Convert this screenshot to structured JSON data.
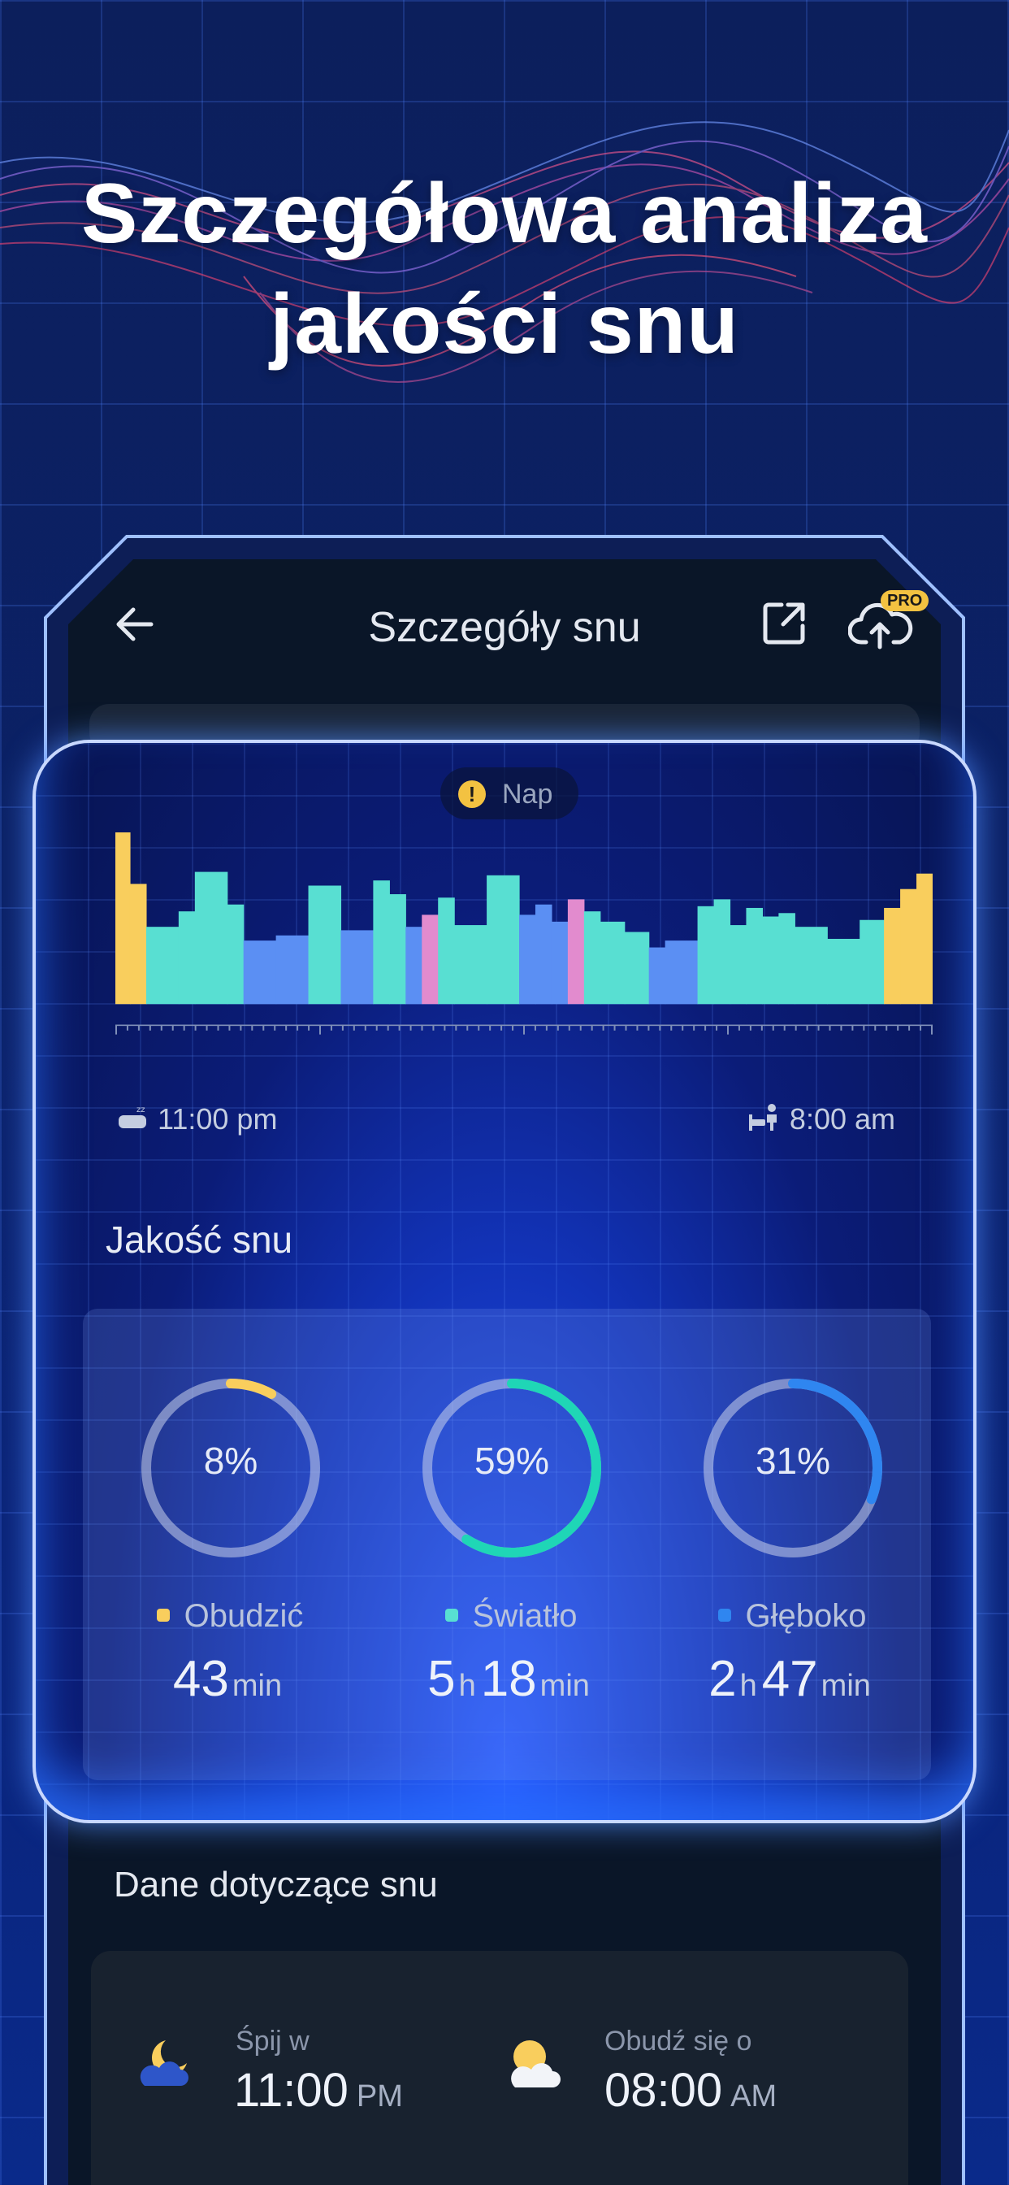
{
  "headline": "Szczegółowa analiza jakości snu",
  "header": {
    "title": "Szczegóły snu",
    "pro_badge": "PRO"
  },
  "nap_chip": {
    "icon": "!",
    "label": "Nap"
  },
  "hypnogram": {
    "start_time": "11:00 pm",
    "end_time": "8:00 am",
    "colors": {
      "awake": "#f9ce5d",
      "light": "#58dfd2",
      "deep": "#5b8ff3",
      "rem": "#e28bce"
    },
    "segments": [
      {
        "stage": "awake",
        "level": 1.0,
        "w": 0.018
      },
      {
        "stage": "awake",
        "level": 0.7,
        "w": 0.02
      },
      {
        "stage": "light",
        "level": 0.45,
        "w": 0.04
      },
      {
        "stage": "light",
        "level": 0.54,
        "w": 0.02
      },
      {
        "stage": "light",
        "level": 0.77,
        "w": 0.04
      },
      {
        "stage": "light",
        "level": 0.58,
        "w": 0.02
      },
      {
        "stage": "deep",
        "level": 0.37,
        "w": 0.04
      },
      {
        "stage": "deep",
        "level": 0.4,
        "w": 0.04
      },
      {
        "stage": "light",
        "level": 0.69,
        "w": 0.04
      },
      {
        "stage": "deep",
        "level": 0.43,
        "w": 0.04
      },
      {
        "stage": "light",
        "level": 0.72,
        "w": 0.02
      },
      {
        "stage": "light",
        "level": 0.64,
        "w": 0.02
      },
      {
        "stage": "deep",
        "level": 0.45,
        "w": 0.02
      },
      {
        "stage": "rem",
        "level": 0.52,
        "w": 0.02
      },
      {
        "stage": "light",
        "level": 0.62,
        "w": 0.02
      },
      {
        "stage": "light",
        "level": 0.46,
        "w": 0.04
      },
      {
        "stage": "light",
        "level": 0.75,
        "w": 0.04
      },
      {
        "stage": "deep",
        "level": 0.52,
        "w": 0.02
      },
      {
        "stage": "deep",
        "level": 0.58,
        "w": 0.02
      },
      {
        "stage": "deep",
        "level": 0.48,
        "w": 0.02
      },
      {
        "stage": "rem",
        "level": 0.61,
        "w": 0.02
      },
      {
        "stage": "light",
        "level": 0.54,
        "w": 0.02
      },
      {
        "stage": "light",
        "level": 0.48,
        "w": 0.03
      },
      {
        "stage": "light",
        "level": 0.42,
        "w": 0.03
      },
      {
        "stage": "deep",
        "level": 0.33,
        "w": 0.02
      },
      {
        "stage": "deep",
        "level": 0.37,
        "w": 0.04
      },
      {
        "stage": "light",
        "level": 0.57,
        "w": 0.02
      },
      {
        "stage": "light",
        "level": 0.61,
        "w": 0.02
      },
      {
        "stage": "light",
        "level": 0.46,
        "w": 0.02
      },
      {
        "stage": "light",
        "level": 0.56,
        "w": 0.02
      },
      {
        "stage": "light",
        "level": 0.51,
        "w": 0.02
      },
      {
        "stage": "light",
        "level": 0.53,
        "w": 0.02
      },
      {
        "stage": "light",
        "level": 0.45,
        "w": 0.04
      },
      {
        "stage": "light",
        "level": 0.38,
        "w": 0.04
      },
      {
        "stage": "light",
        "level": 0.49,
        "w": 0.03
      },
      {
        "stage": "awake",
        "level": 0.56,
        "w": 0.02
      },
      {
        "stage": "awake",
        "level": 0.67,
        "w": 0.02
      },
      {
        "stage": "awake",
        "level": 0.76,
        "w": 0.02
      }
    ]
  },
  "quality": {
    "title": "Jakość snu",
    "stats": [
      {
        "label": "Obudzić",
        "percent_text": "8%",
        "fraction": 0.08,
        "color": "#f9ce5d",
        "start": 0.0,
        "parts": [
          {
            "num": "43",
            "unit": "min"
          }
        ]
      },
      {
        "label": "Światło",
        "percent_text": "59%",
        "fraction": 0.59,
        "color": "#1fd6b6",
        "start": 0.0,
        "parts": [
          {
            "num": "5",
            "unit": "h"
          },
          {
            "num": "18",
            "unit": "min"
          }
        ]
      },
      {
        "label": "Głęboko",
        "percent_text": "31%",
        "fraction": 0.31,
        "color": "#2f86f0",
        "start": 0.0,
        "parts": [
          {
            "num": "2",
            "unit": "h"
          },
          {
            "num": "47",
            "unit": "min"
          }
        ]
      }
    ],
    "stat_0": {
      "label": "Obudzić",
      "percent": "8%",
      "num": "43",
      "unit": "min"
    },
    "stat_1": {
      "label": "Światło",
      "percent": "59%",
      "num1": "5",
      "unit1": "h",
      "num2": "18",
      "unit2": "min"
    },
    "stat_2": {
      "label": "Głęboko",
      "percent": "31%",
      "num1": "2",
      "unit1": "h",
      "num2": "47",
      "unit2": "min"
    }
  },
  "sleep_data": {
    "title": "Dane dotyczące snu",
    "sleep_label": "Śpij w",
    "sleep_time": "11:00",
    "sleep_ampm": "PM",
    "wake_label": "Obudź się o",
    "wake_time": "08:00",
    "wake_ampm": "AM"
  }
}
